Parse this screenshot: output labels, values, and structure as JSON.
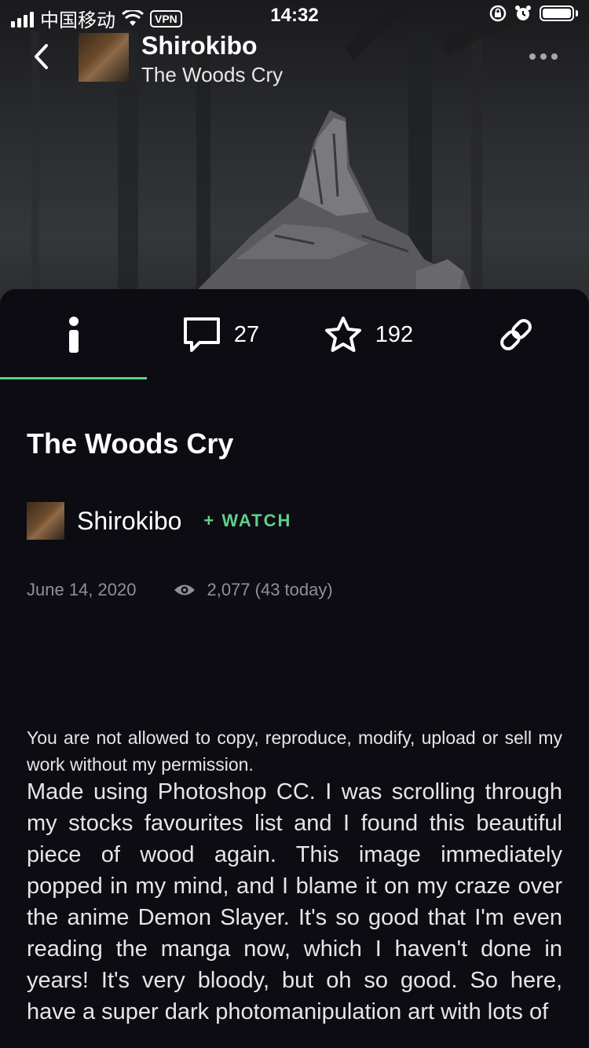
{
  "status_bar": {
    "carrier": "中国移动",
    "vpn": "VPN",
    "time": "14:32"
  },
  "header": {
    "author": "Shirokibo",
    "title": "The Woods Cry"
  },
  "tabs": {
    "comments_count": "27",
    "favourites_count": "192"
  },
  "deviation": {
    "title": "The Woods Cry",
    "author": "Shirokibo",
    "watch_label": "+ WATCH",
    "date": "June 14, 2020",
    "views": "2,077 (43 today)"
  },
  "description": {
    "copyright": "You are not allowed to copy, reproduce, modify, upload or sell my work without my permission.",
    "body": "Made using Photoshop CC. I was scrolling through my stocks favourites list and I found this beautiful piece of wood again. This image immediately popped in my mind, and I blame it on my craze over the anime Demon Slayer. It's so good that I'm even reading the manga now, which I haven't done in years! It's very bloody, but oh so good. So here, have a super dark photomanipulation art with lots of"
  },
  "colors": {
    "accent": "#5fd08c",
    "background": "#0c0c12",
    "muted_text": "#8f8f95"
  }
}
